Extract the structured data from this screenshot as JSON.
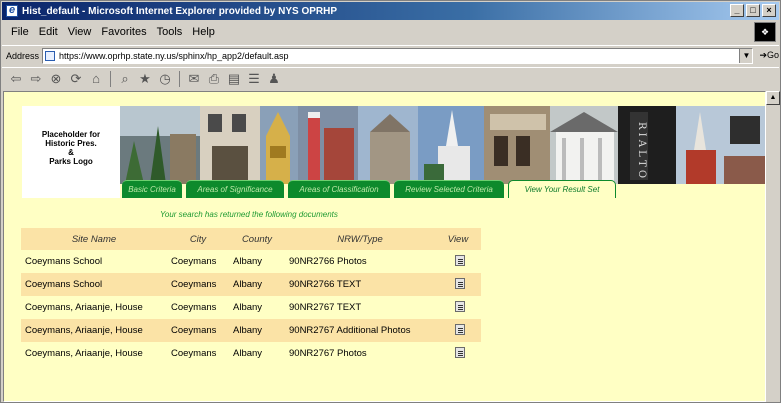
{
  "window": {
    "title": "Hist_default - Microsoft Internet Explorer provided by NYS OPRHP",
    "controls": [
      "_",
      "□",
      "×"
    ]
  },
  "menu": [
    "File",
    "Edit",
    "View",
    "Favorites",
    "Tools",
    "Help"
  ],
  "address": {
    "label": "Address",
    "url": "https://www.oprhp.state.ny.us/sphinx/hp_app2/default.asp",
    "go_label": "Go"
  },
  "toolbar_icons": [
    "back-icon",
    "forward-icon",
    "stop-icon",
    "refresh-icon",
    "home-icon",
    "search-icon",
    "favorites-icon",
    "history-icon",
    "mail-icon",
    "print-icon",
    "edit-icon",
    "discuss-icon",
    "messenger-icon"
  ],
  "logo": {
    "lines": [
      "Placeholder for",
      "Historic Pres.",
      "&",
      "Parks Logo"
    ]
  },
  "tabs": [
    {
      "label": "Basic Criteria",
      "active": false
    },
    {
      "label": "Areas of Significance",
      "active": false
    },
    {
      "label": "Areas of Classification",
      "active": false
    },
    {
      "label": "Review Selected Criteria",
      "active": false
    },
    {
      "label": "View Your Result Set",
      "active": true
    }
  ],
  "notice": "Your search has returned the following documents",
  "table": {
    "headers": [
      "Site Name",
      "City",
      "County",
      "NRW/Type",
      "View"
    ],
    "rows": [
      [
        "Coeymans School",
        "Coeymans",
        "Albany",
        "90NR2766 Photos"
      ],
      [
        "Coeymans School",
        "Coeymans",
        "Albany",
        "90NR2766 TEXT"
      ],
      [
        "Coeymans, Ariaanje, House",
        "Coeymans",
        "Albany",
        "90NR2767 TEXT"
      ],
      [
        "Coeymans, Ariaanje, House",
        "Coeymans",
        "Albany",
        "90NR2767 Additional Photos"
      ],
      [
        "Coeymans, Ariaanje, House",
        "Coeymans",
        "Albany",
        "90NR2767 Photos"
      ]
    ]
  },
  "colors": {
    "page_bg": "#ffffc4",
    "row_alt": "#fbe3a6",
    "tab_green": "#0d8a2c",
    "notice_green": "#1f9a32"
  }
}
